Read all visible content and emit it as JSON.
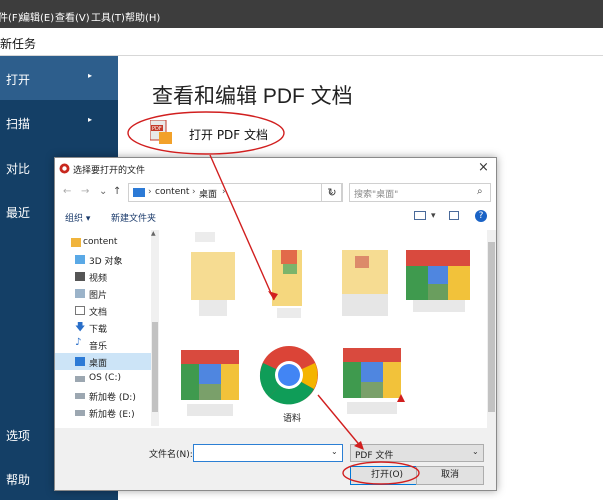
{
  "menubar": {
    "items": [
      "件(F)",
      "编辑(E)",
      "查看(V)",
      "工具(T)",
      "帮助(H)"
    ]
  },
  "toolbar_strip": {
    "title": "新任务"
  },
  "sidebar": {
    "items": [
      {
        "label": "打开",
        "arrow": "▸"
      },
      {
        "label": "扫描",
        "arrow": "▸"
      },
      {
        "label": "对比"
      },
      {
        "label": "最近"
      },
      {
        "label": "选项"
      },
      {
        "label": "帮助"
      }
    ]
  },
  "main": {
    "title": "查看和编辑 PDF 文档",
    "open_link": "打开 PDF 文档"
  },
  "dialog": {
    "title": "选择要打开的文件",
    "close": "×",
    "nav": {
      "back": "←",
      "forward": "→",
      "recent": "⌄",
      "up": "↑",
      "path": [
        "content",
        "桌面"
      ],
      "refresh": "↻",
      "search_placeholder": "搜索\"桌面\""
    },
    "toolbar": {
      "organize": "组织 ▾",
      "new_folder": "新建文件夹"
    },
    "tree": [
      {
        "label": "content",
        "icon": "user-folder-icon"
      },
      {
        "label": "3D 对象",
        "icon": "cube-icon"
      },
      {
        "label": "视频",
        "icon": "video-icon"
      },
      {
        "label": "图片",
        "icon": "picture-icon"
      },
      {
        "label": "文档",
        "icon": "document-icon"
      },
      {
        "label": "下载",
        "icon": "download-icon"
      },
      {
        "label": "音乐",
        "icon": "music-icon"
      },
      {
        "label": "桌面",
        "icon": "desktop-icon",
        "selected": true
      },
      {
        "label": "OS (C:)",
        "icon": "drive-icon"
      },
      {
        "label": "新加卷 (D:)",
        "icon": "drive-icon"
      },
      {
        "label": "新加卷 (E:)",
        "icon": "drive-icon"
      }
    ],
    "files": {
      "visible_label": "语料"
    },
    "bottom": {
      "filename_label": "文件名(N):",
      "filename_value": "",
      "filetype": "PDF 文件",
      "open_button": "打开(O)",
      "cancel_button": "取消"
    }
  },
  "colors": {
    "sidebar_bg": "#143f66",
    "sidebar_active": "#2d5e8c",
    "annotation_red": "#d11f1f",
    "accent_blue": "#0078d7"
  }
}
